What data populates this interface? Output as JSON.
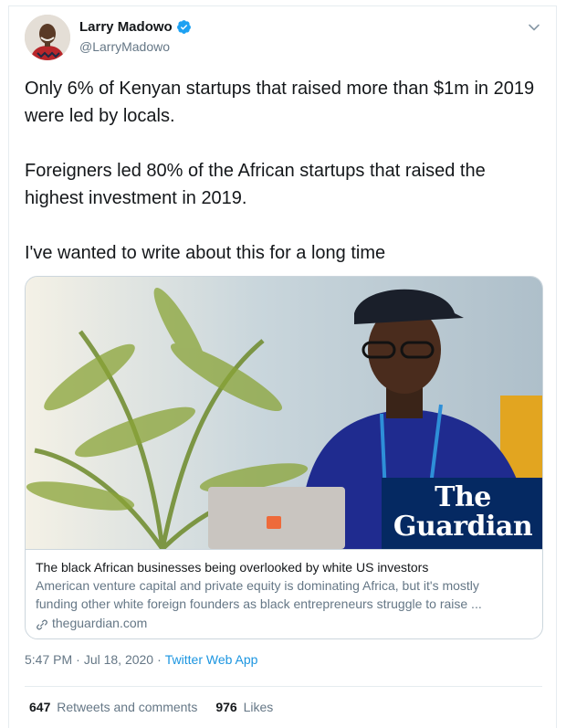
{
  "author": {
    "display_name": "Larry Madowo",
    "handle": "@LarryMadowo",
    "verified": true,
    "avatar_icon": "profile-avatar"
  },
  "tweet": {
    "paragraphs": [
      "Only 6% of Kenyan startups that raised more than $1m in 2019 were led by locals.",
      "Foreigners led 80% of the African startups that raised the highest investment in 2019.",
      "I've wanted to write about this for a long time"
    ]
  },
  "card": {
    "image_icon": "article-photo",
    "image_brand_line1": "The",
    "image_brand_line2": "Guardian",
    "title": "The black African businesses being overlooked by white US investors",
    "description_line1": "American venture capital and private equity is dominating Africa, but it's mostly",
    "description_line2": "funding other white foreign founders as black entrepreneurs struggle to raise ...",
    "domain": "theguardian.com"
  },
  "meta": {
    "time": "5:47 PM",
    "sep1": "·",
    "date": "Jul 18, 2020",
    "sep2": "·",
    "source": "Twitter Web App"
  },
  "stats": {
    "retweets_count": "647",
    "retweets_label": "Retweets and comments",
    "likes_count": "976",
    "likes_label": "Likes"
  },
  "colors": {
    "link": "#1b95e0",
    "secondary_text": "#657786",
    "guardian_blue": "#052962"
  }
}
